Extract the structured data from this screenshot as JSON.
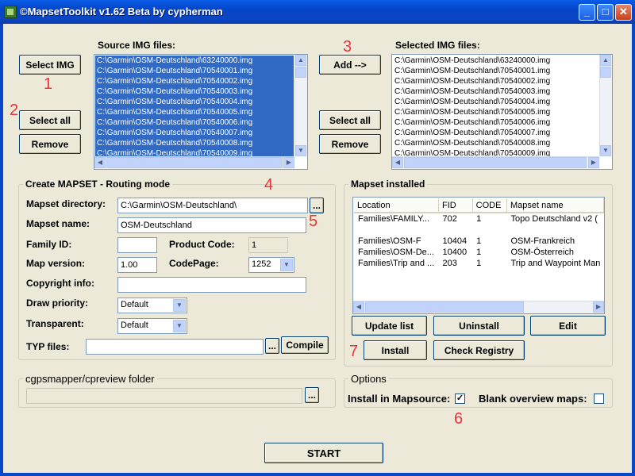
{
  "window": {
    "title": "©MapsetToolkit v1.62 Beta by cypherman",
    "min_icon": "minimize-icon",
    "max_icon": "maximize-icon",
    "close_icon": "close-icon"
  },
  "source": {
    "label": "Source IMG files:",
    "items": [
      "C:\\Garmin\\OSM-Deutschland\\63240000.img",
      "C:\\Garmin\\OSM-Deutschland\\70540001.img",
      "C:\\Garmin\\OSM-Deutschland\\70540002.img",
      "C:\\Garmin\\OSM-Deutschland\\70540003.img",
      "C:\\Garmin\\OSM-Deutschland\\70540004.img",
      "C:\\Garmin\\OSM-Deutschland\\70540005.img",
      "C:\\Garmin\\OSM-Deutschland\\70540006.img",
      "C:\\Garmin\\OSM-Deutschland\\70540007.img",
      "C:\\Garmin\\OSM-Deutschland\\70540008.img",
      "C:\\Garmin\\OSM-Deutschland\\70540009.img"
    ]
  },
  "selected": {
    "label": "Selected IMG files:",
    "items": [
      "C:\\Garmin\\OSM-Deutschland\\63240000.img",
      "C:\\Garmin\\OSM-Deutschland\\70540001.img",
      "C:\\Garmin\\OSM-Deutschland\\70540002.img",
      "C:\\Garmin\\OSM-Deutschland\\70540003.img",
      "C:\\Garmin\\OSM-Deutschland\\70540004.img",
      "C:\\Garmin\\OSM-Deutschland\\70540005.img",
      "C:\\Garmin\\OSM-Deutschland\\70540006.img",
      "C:\\Garmin\\OSM-Deutschland\\70540007.img",
      "C:\\Garmin\\OSM-Deutschland\\70540008.img",
      "C:\\Garmin\\OSM-Deutschland\\70540009.img"
    ]
  },
  "buttons": {
    "select_img": "Select IMG",
    "select_all_left": "Select all",
    "remove_left": "Remove",
    "add": "Add -->",
    "select_all_right": "Select all",
    "remove_right": "Remove",
    "browse": "...",
    "compile": "Compile",
    "update_list": "Update list",
    "uninstall": "Uninstall",
    "edit": "Edit",
    "install": "Install",
    "check_registry": "Check Registry",
    "start": "START"
  },
  "annotations": {
    "n1": "1",
    "n2": "2",
    "n3": "3",
    "n4": "4",
    "n5": "5",
    "n6": "6",
    "n7": "7"
  },
  "create": {
    "title": "Create MAPSET - Routing mode",
    "mapset_directory_label": "Mapset directory:",
    "mapset_directory": "C:\\Garmin\\OSM-Deutschland\\",
    "mapset_name_label": "Mapset name:",
    "mapset_name": "OSM-Deutschland",
    "family_id_label": "Family ID:",
    "family_id": "",
    "product_code_label": "Product Code:",
    "product_code": "1",
    "map_version_label": "Map version:",
    "map_version": "1.00",
    "codepage_label": "CodePage:",
    "codepage": "1252",
    "copyright_label": "Copyright info:",
    "copyright": "",
    "draw_priority_label": "Draw priority:",
    "draw_priority": "Default",
    "transparent_label": "Transparent:",
    "transparent": "Default",
    "typ_label": "TYP files:",
    "typ": ""
  },
  "installed": {
    "title": "Mapset installed",
    "columns": [
      "Location",
      "FID",
      "CODE",
      "Mapset name"
    ],
    "rows": [
      [
        "Families\\FAMILY...",
        "702",
        "1",
        "Topo Deutschland v2 ("
      ],
      [
        "",
        "",
        "",
        ""
      ],
      [
        "Families\\OSM-F",
        "10404",
        "1",
        "OSM-Frankreich"
      ],
      [
        "Families\\OSM-De...",
        "10400",
        "1",
        "OSM-Österreich"
      ],
      [
        "Families\\Trip and ...",
        "203",
        "1",
        "Trip and Waypoint Man"
      ]
    ]
  },
  "cgps": {
    "title": "cgpsmapper/cpreview folder",
    "value": ""
  },
  "options": {
    "title": "Options",
    "install_in_mapsource_label": "Install in Mapsource:",
    "install_in_mapsource": true,
    "blank_overview_label": "Blank overview maps:",
    "blank_overview": false
  }
}
